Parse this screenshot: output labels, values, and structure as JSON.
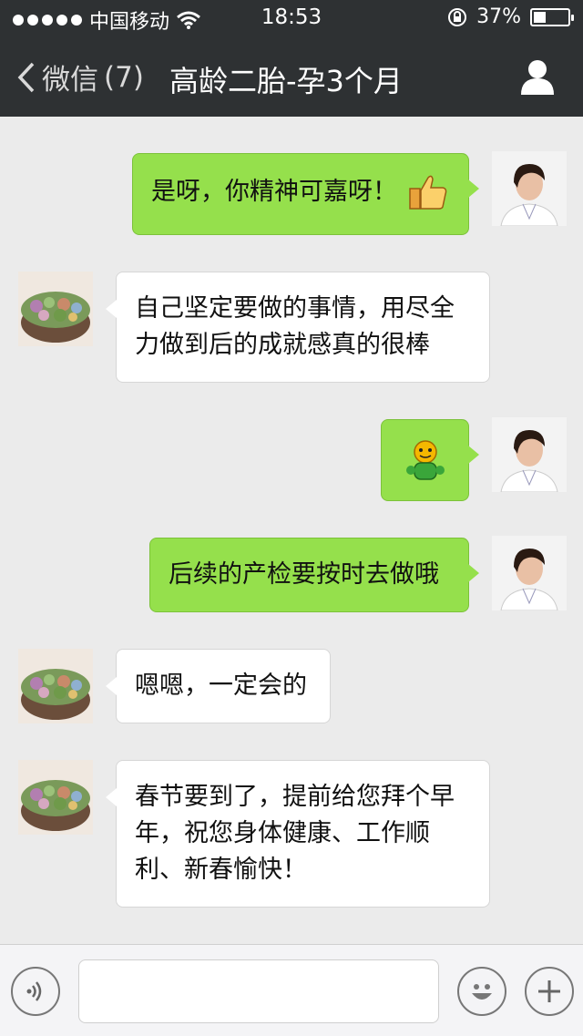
{
  "status_bar": {
    "carrier": "中国移动",
    "time": "18:53",
    "battery_percent": "37%",
    "battery_level": 0.37,
    "icons": [
      "signal-dots-icon",
      "wifi-icon",
      "rotation-lock-icon",
      "battery-icon"
    ]
  },
  "nav": {
    "back_label": "微信",
    "unread_count": "(7)",
    "title": "高龄二胎-孕3个月",
    "icons": [
      "chevron-left-icon",
      "user-icon"
    ]
  },
  "messages": [
    {
      "sender": "me",
      "text": "是呀，你精神可嘉呀！",
      "emoji": "thumbs-up-icon"
    },
    {
      "sender": "other",
      "text": "自己坚定要做的事情，用尽全力做到后的成就感真的很棒"
    },
    {
      "sender": "me",
      "text": "",
      "emoji": "green-smiley-sticker-icon"
    },
    {
      "sender": "me",
      "text": "后续的产检要按时去做哦"
    },
    {
      "sender": "other",
      "text": "嗯嗯，一定会的"
    },
    {
      "sender": "other",
      "text": "春节要到了，提前给您拜个早年，祝您身体健康、工作顺利、新春愉快！"
    }
  ],
  "colors": {
    "my_bubble": "#95e04c",
    "other_bubble": "#ffffff",
    "header": "#2e3133",
    "chat_bg": "#ebebeb"
  },
  "toolbar": {
    "input_value": "",
    "icons": [
      "voice-icon",
      "emoji-icon",
      "plus-icon"
    ]
  }
}
